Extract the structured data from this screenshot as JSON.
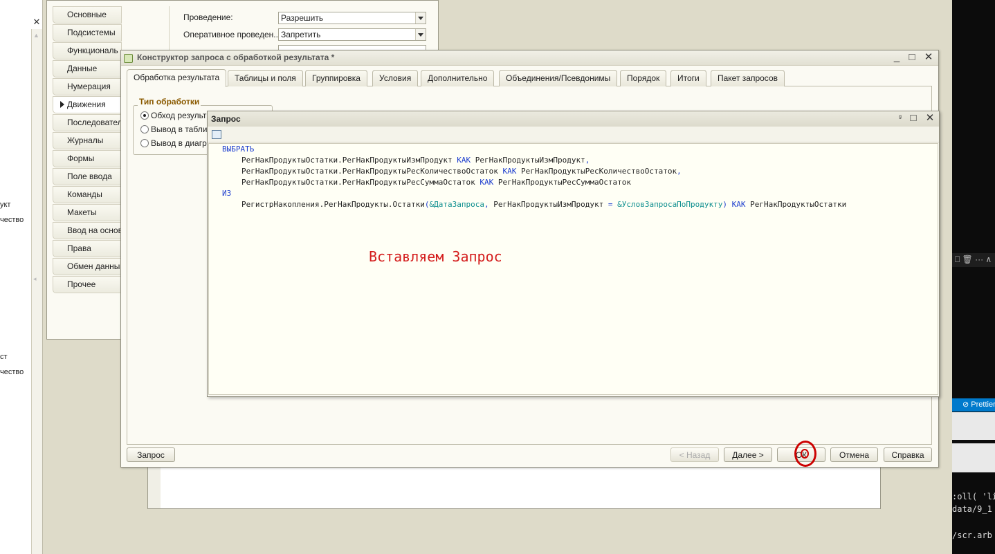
{
  "left_panel": {
    "close_glyph": "✕",
    "fragments": [
      "укт",
      "чество",
      "ст",
      "чество"
    ],
    "scroll_up": "▲",
    "scroll_mid": "◂"
  },
  "bg_window": {
    "nav": [
      "Основные",
      "Подсистемы",
      "Функциональ",
      "Данные",
      "Нумерация",
      "Движения",
      "Последователь",
      "Журналы",
      "Формы",
      "Поле ввода",
      "Команды",
      "Макеты",
      "Ввод на основ",
      "Права",
      "Обмен данны",
      "Прочее"
    ],
    "active_nav_index": 5,
    "props": [
      {
        "label": "Проведение:",
        "value": "Разрешить"
      },
      {
        "label": "Оперативное проведен...",
        "value": "Запретить"
      }
    ]
  },
  "constructor": {
    "title": "Конструктор запроса с обработкой результата *",
    "tabs": [
      "Обработка результата",
      "Таблицы и поля",
      "Группировка",
      "Условия",
      "Дополнительно",
      "Объединения/Псевдонимы",
      "Порядок",
      "Итоги",
      "Пакет запросов"
    ],
    "active_tab_index": 0,
    "group_title": "Тип обработки",
    "radio_options": [
      "Обход результ",
      "Вывод в табли",
      "Вывод в диагр"
    ],
    "selected_radio_index": 0,
    "buttons": {
      "query": "Запрос",
      "back": "< Назад",
      "next": "Далее >",
      "ok": "ОК",
      "cancel": "Отмена",
      "help": "Справка"
    },
    "window_controls": {
      "minimize": "_",
      "maximize": "□",
      "close": "✕"
    },
    "highlight_color": "#cc0000"
  },
  "query_window": {
    "title": "Запрос",
    "controls": {
      "pin": "ᵍ",
      "maximize": "□",
      "close": "✕"
    },
    "code": {
      "select_kw": "ВЫБРАТЬ",
      "line1_field": "РегНакПродуктыОстатки.РегНакПродуктыИзмПродукт",
      "line1_alias": "РегНакПродуктыИзмПродукт",
      "line2_field": "РегНакПродуктыОстатки.РегНакПродуктыРесКоличествоОстаток",
      "line2_alias": "РегНакПродуктыРесКоличествоОстаток",
      "line3_field": "РегНакПродуктыОстатки.РегНакПродуктыРесСуммаОстаток",
      "line3_alias": "РегНакПродуктыРесСуммаОстаток",
      "as_kw": "КАК",
      "comma": ",",
      "from_kw": "ИЗ",
      "source_func": "РегистрНакопления.РегНакПродукты.Остатки",
      "open_paren": "(",
      "param1": "&ДатаЗапроса",
      "cond_field": "РегНакПродуктыИзмПродукт",
      "eq": "=",
      "param2": "&УсловЗапросаПоПродукту",
      "close_paren": ")",
      "source_alias": "РегНакПродуктыОстатки"
    },
    "annotation": "Вставляем Запрос",
    "colors": {
      "keyword": "#1f3fcf",
      "parameter": "#0f8f8f",
      "annotation": "#d41c1c"
    }
  },
  "terminal": {
    "tools": "⎕ 🗑 ··· ∧",
    "status": "⊘ Prettier",
    "lines": [
      ":oll( 'li",
      "data/9_1",
      "/scr.arb"
    ]
  }
}
